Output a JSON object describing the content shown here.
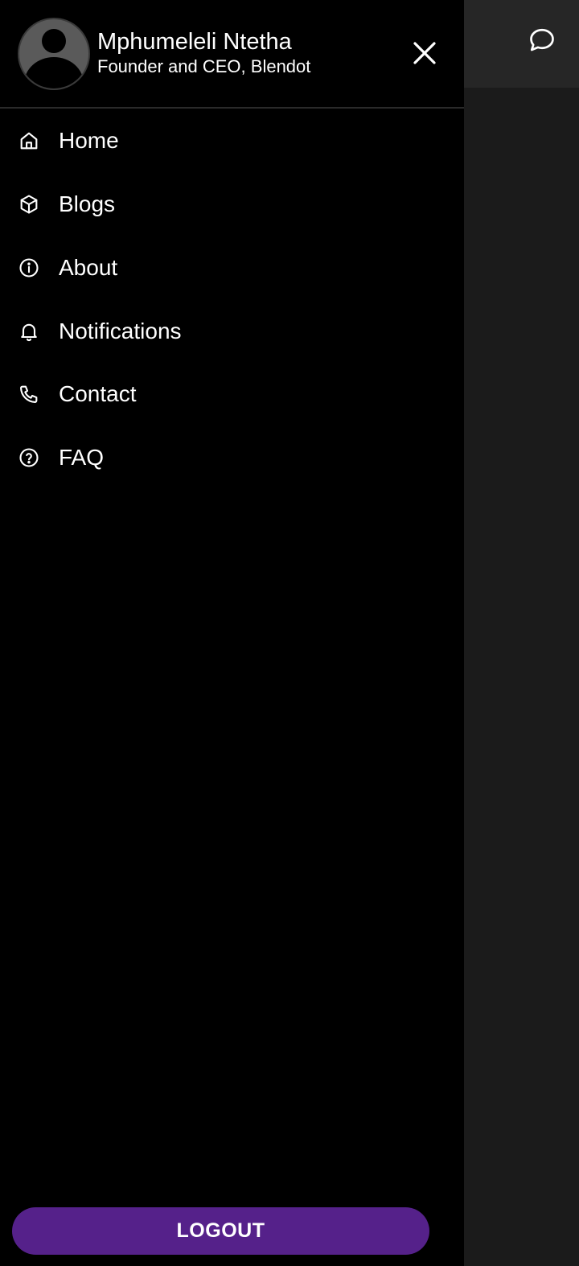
{
  "profile": {
    "name": "Mphumeleli Ntetha",
    "role": "Founder and CEO, Blendot"
  },
  "nav": {
    "items": [
      {
        "label": "Home",
        "icon": "home-icon"
      },
      {
        "label": "Blogs",
        "icon": "cube-icon"
      },
      {
        "label": "About",
        "icon": "info-icon"
      },
      {
        "label": "Notifications",
        "icon": "bell-icon"
      },
      {
        "label": "Contact",
        "icon": "phone-icon"
      },
      {
        "label": "FAQ",
        "icon": "question-icon"
      }
    ]
  },
  "actions": {
    "logout_label": "LOGOUT"
  },
  "colors": {
    "drawer_bg": "#000000",
    "page_bg": "#1b1b1b",
    "topbar_bg": "#262626",
    "logout_bg": "#55218a",
    "text": "#ffffff"
  }
}
